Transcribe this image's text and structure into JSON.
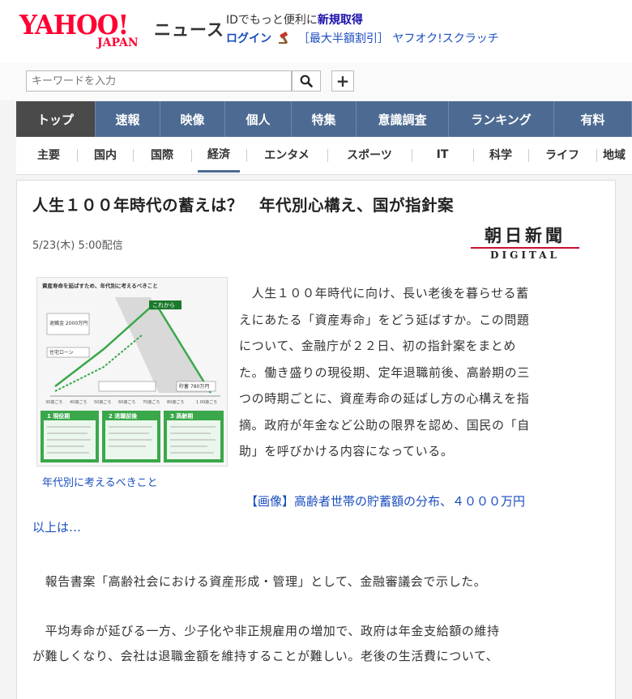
{
  "header": {
    "logo_main": "YAHOO!",
    "logo_sub": "JAPAN",
    "service": "ニュース",
    "promo_prefix": "IDでもっと便利に",
    "promo_link": "新規取得",
    "login": "ログイン",
    "auction_text": "［最大半額割引］ ヤフオク!スクラッチ"
  },
  "search": {
    "placeholder": "キーワードを入力"
  },
  "main_nav": [
    {
      "label": "トップ",
      "active": true
    },
    {
      "label": "速報"
    },
    {
      "label": "映像"
    },
    {
      "label": "個人"
    },
    {
      "label": "特集"
    },
    {
      "label": "意識調査"
    },
    {
      "label": "ランキング"
    },
    {
      "label": "有料"
    }
  ],
  "sub_nav": [
    {
      "label": "主要"
    },
    {
      "label": "国内"
    },
    {
      "label": "国際"
    },
    {
      "label": "経済",
      "active": true
    },
    {
      "label": "エンタメ"
    },
    {
      "label": "スポーツ"
    },
    {
      "label": "IT"
    },
    {
      "label": "科学"
    },
    {
      "label": "ライフ"
    },
    {
      "label": "地域"
    }
  ],
  "article": {
    "title": "人生１００年時代の蓄えは？　年代別心構え、国が指針案",
    "date": "5/23(木) 5:00配信",
    "source_jp": "朝日新聞",
    "source_en": "DIGITAL",
    "figure_caption": "年代別に考えるべきこと",
    "figure": {
      "title": "資産寿命を延ばすため、年代別に考えるべきこと",
      "tag_now": "これから",
      "box1": "退職金 2000万円",
      "box2": "住宅ローン",
      "box3": "貯蓄 780万円",
      "panels": [
        "1 現役期",
        "2 退職前後",
        "3 高齢期"
      ],
      "ages": [
        "30歳ごろ",
        "40歳ごろ",
        "50歳ごろ",
        "60歳ごろ",
        "70歳ごろ",
        "80歳ごろ",
        "1 00歳ごろ"
      ]
    },
    "lead_lines": [
      "　人生１００年時代に向け、長い老後を暮らせる蓄",
      "えにあたる「資産寿命」をどう延ばすか。この問題",
      "について、金融庁が２２日、初の指針案をまとめ",
      "た。働き盛りの現役期、定年退職前後、高齢期の三",
      "つの時期ごとに、資産寿命の延ばし方の心構えを指",
      "摘。政府が年金など公助の限界を認め、国民の「自",
      "助」を呼びかける内容になっている。"
    ],
    "related_link": "【画像】高齢者世帯の貯蓄額の分布、４０００万円",
    "more": "以上は…",
    "para2": "　報告書案「高齢社会における資産形成・管理」として、金融審議会で示した。",
    "para3_lines": [
      "　平均寿命が延びる一方、少子化や非正規雇用の増加で、政府は年金支給額の維持",
      "が難しくなり、会社は退職金額を維持することが難しい。老後の生活費について、"
    ]
  }
}
